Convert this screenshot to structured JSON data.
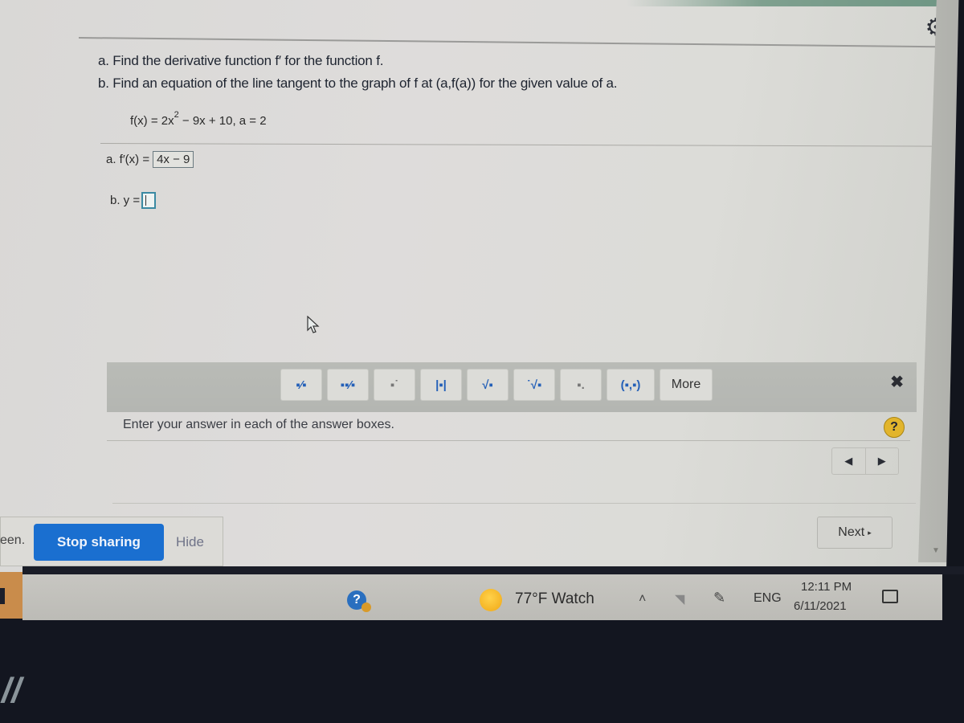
{
  "header": {
    "settings_icon": "gear-icon"
  },
  "question": {
    "part_a": "a. Find the derivative function f′ for the function f.",
    "part_b": "b. Find an equation of the line tangent to the graph of f at (a,f(a)) for the given value of a.",
    "function_prefix": "f(x) = 2x",
    "function_exponent": "2",
    "function_suffix": " − 9x + 10, a = 2"
  },
  "answers": {
    "a_label": "a. f′(x) =",
    "a_value": "4x − 9",
    "b_label": "b. y =",
    "b_value": ""
  },
  "math_toolbar": {
    "buttons": [
      {
        "name": "fraction",
        "glyph": "▪⁄▪"
      },
      {
        "name": "mixed-number",
        "glyph": "▪▪⁄▪"
      },
      {
        "name": "exponent",
        "glyph": "▪˙"
      },
      {
        "name": "absolute-value",
        "glyph": "|▪|"
      },
      {
        "name": "square-root",
        "glyph": "√▪"
      },
      {
        "name": "nth-root",
        "glyph": "˙√▪"
      },
      {
        "name": "subscript",
        "glyph": "▪."
      },
      {
        "name": "ordered-pair",
        "glyph": "(▪,▪)"
      }
    ],
    "more_label": "More",
    "close_glyph": "✖"
  },
  "hint": "Enter your answer in each of the answer boxes.",
  "help_glyph": "?",
  "nav": {
    "prev_glyph": "◀",
    "next_glyph": "▶",
    "next_label": "Next",
    "next_arrow": "▸"
  },
  "sharing": {
    "text_fragment": "een.",
    "stop_label": "Stop sharing",
    "hide_label": "Hide"
  },
  "taskbar": {
    "help_glyph": "?",
    "weather": "77°F  Watch",
    "chevron": "˄",
    "wifi": "◥",
    "pen": "✎",
    "language": "ENG",
    "time": "12:11 PM",
    "date": "6/11/2021"
  }
}
